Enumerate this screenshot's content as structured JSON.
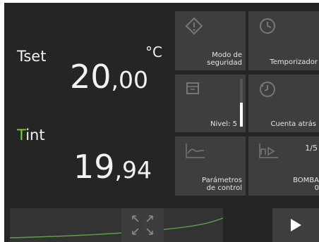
{
  "readouts": {
    "tset_label": "Tset",
    "unit": "°C",
    "tset_int": "20",
    "tset_dec": ",00",
    "tint_label_first": "T",
    "tint_label_rest": "int",
    "tint_int": "19",
    "tint_dec": ",94"
  },
  "tiles": {
    "safety_mode": {
      "line1": "Modo de",
      "line2": "seguridad",
      "icon": "warning-icon"
    },
    "timer": {
      "label": "Temporizador",
      "icon": "clock-icon"
    },
    "level": {
      "label": "Nivel: 5",
      "icon": "bath-icon",
      "level_fraction": 0.5
    },
    "countdown": {
      "label": "Cuenta atrás",
      "icon": "countdown-icon"
    },
    "control_params": {
      "line1": "Parámetros",
      "line2": "de control",
      "icon": "control-curve-icon"
    },
    "pump": {
      "page": "1/5",
      "label": "BOMBA",
      "value": "0",
      "icon": "pump-icon"
    }
  },
  "bottom": {
    "graph_icon": "expand-arrows-icon",
    "play_icon": "play-icon"
  },
  "colors": {
    "background": "#252525",
    "tile": "#3e3e3e",
    "tint_accent": "#7fd13b",
    "graph_line": "#5aa040"
  }
}
